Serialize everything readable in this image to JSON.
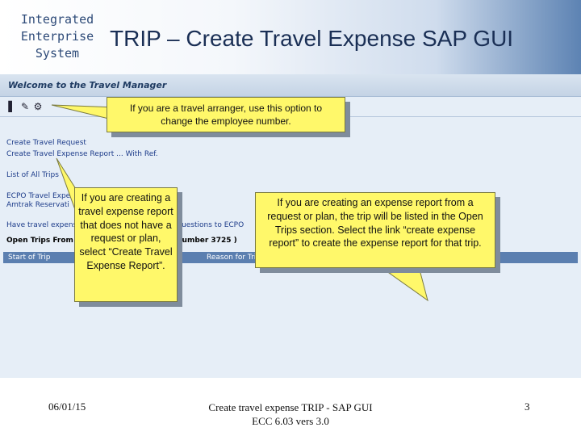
{
  "header": {
    "org_lines": [
      "Integrated",
      "Enterprise",
      "System"
    ],
    "title": "TRIP – Create Travel Expense SAP GUI"
  },
  "sap": {
    "window_title": "Welcome to the Travel Manager",
    "toolbar_icons": [
      "id-card-icon",
      "edit-list-icon",
      "user-change-icon"
    ],
    "links": {
      "create_travel_request": "Create Travel Request",
      "create_expense_report": "Create Travel Expense Report ... With Ref.",
      "list_all": "List of All Trips",
      "ecpo": "ECPO Travel Expense R",
      "amtrak": "Amtrak Reservati",
      "have_travel": "Have travel expense",
      "questions": "Questions to ECPO",
      "open_trips": "Open Trips From Comp",
      "number": "Number 3725 )"
    },
    "table_columns": [
      "Start of Trip",
      "Reason for Trip"
    ]
  },
  "callouts": {
    "arranger": "If you are a travel arranger, use this option to change the employee number.",
    "create_report": "If you are creating a travel expense report that does not have a request or plan, select “Create Travel Expense Report”.",
    "open_trips": "If you are creating an expense report from a request or plan, the trip will be listed in the Open Trips section.  Select the link “create expense report” to create the expense report for that trip."
  },
  "footer": {
    "date": "06/01/15",
    "center": "Create travel expense TRIP - SAP GUI ECC 6.03 vers 3.0",
    "page": "3"
  },
  "colors": {
    "callout_fill": "#fff86a",
    "sap_background": "#e6eef7",
    "title_color": "#1a2f55"
  }
}
